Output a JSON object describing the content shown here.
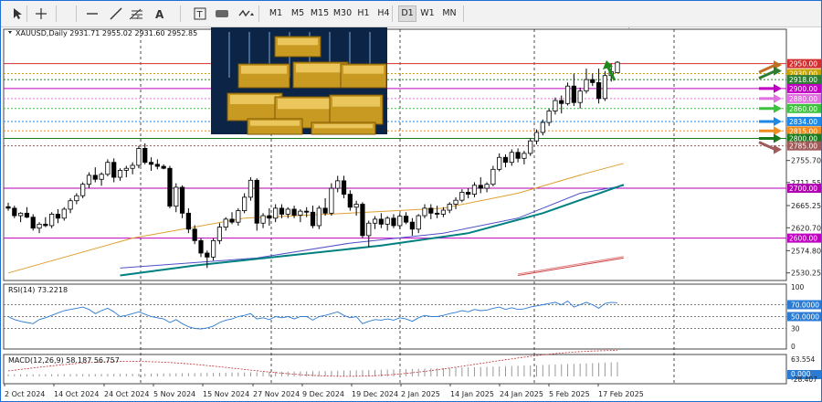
{
  "toolbar": {
    "tools": [
      "cursor-icon",
      "crosshair-icon",
      "horizontal-line-icon",
      "trend-line-icon",
      "fibonacci-icon",
      "text-icon",
      "text-label-icon",
      "rectangle-icon",
      "arrows-icon"
    ],
    "timeframes": [
      "M1",
      "M5",
      "M15",
      "M30",
      "H1",
      "H4",
      "D1",
      "W1",
      "MN"
    ],
    "active_timeframe": "D1"
  },
  "chart_data": {
    "type": "candlestick",
    "symbol_header": "XAUUSD,Daily  2931.71 2955.02 2931.60 2952.85",
    "y_ticks": [
      "2755.70",
      "2711.55",
      "2665.25",
      "2620.70",
      "2574.80",
      "2530.25"
    ],
    "x_ticks": [
      "2 Oct 2024",
      "14 Oct 2024",
      "24 Oct 2024",
      "5 Nov 2024",
      "15 Nov 2024",
      "27 Nov 2024",
      "9 Dec 2024",
      "19 Dec 2024",
      "2 Jan 2025",
      "14 Jan 2025",
      "24 Jan 2025",
      "5 Feb 2025",
      "17 Feb 2025"
    ],
    "ylim": [
      2515,
      3008
    ],
    "levels": [
      {
        "price": 2950,
        "label": "2950.00",
        "color": "#d32f2f"
      },
      {
        "price": 2930,
        "label": "2930.00",
        "color": "#c8a300"
      },
      {
        "price": 2918,
        "label": "2918.00",
        "color": "#2e7d32"
      },
      {
        "price": 2900,
        "label": "2900.00",
        "color": "#c000c0"
      },
      {
        "price": 2880,
        "label": "2880.00",
        "color": "#e070e0"
      },
      {
        "price": 2860,
        "label": "2860.00",
        "color": "#3cc23c"
      },
      {
        "price": 2834,
        "label": "2834.00",
        "color": "#1e88e5"
      },
      {
        "price": 2815,
        "label": "2815.00",
        "color": "#f08c1e"
      },
      {
        "price": 2800,
        "label": "2800.00",
        "color": "#1b7a1b"
      },
      {
        "price": 2785,
        "label": "2785.00",
        "color": "#a05a5a"
      },
      {
        "price": 2700,
        "label": "2700.00",
        "color": "#b000b0"
      },
      {
        "price": 2600,
        "label": "2600.00",
        "color": "#c000c0"
      }
    ],
    "candles": [
      [
        2663,
        2671,
        2655,
        2660
      ],
      [
        2660,
        2665,
        2640,
        2645
      ],
      [
        2645,
        2652,
        2632,
        2650
      ],
      [
        2650,
        2662,
        2640,
        2642
      ],
      [
        2642,
        2648,
        2615,
        2620
      ],
      [
        2620,
        2632,
        2610,
        2628
      ],
      [
        2628,
        2642,
        2622,
        2625
      ],
      [
        2625,
        2652,
        2620,
        2648
      ],
      [
        2648,
        2658,
        2630,
        2640
      ],
      [
        2640,
        2662,
        2635,
        2658
      ],
      [
        2658,
        2680,
        2650,
        2675
      ],
      [
        2675,
        2690,
        2668,
        2685
      ],
      [
        2685,
        2712,
        2680,
        2708
      ],
      [
        2708,
        2732,
        2700,
        2726
      ],
      [
        2726,
        2742,
        2712,
        2718
      ],
      [
        2718,
        2732,
        2705,
        2728
      ],
      [
        2728,
        2758,
        2724,
        2752
      ],
      [
        2752,
        2760,
        2712,
        2722
      ],
      [
        2722,
        2740,
        2715,
        2736
      ],
      [
        2736,
        2745,
        2722,
        2740
      ],
      [
        2740,
        2752,
        2728,
        2746
      ],
      [
        2746,
        2785,
        2740,
        2780
      ],
      [
        2780,
        2790,
        2748,
        2752
      ],
      [
        2752,
        2762,
        2735,
        2748
      ],
      [
        2748,
        2758,
        2738,
        2744
      ],
      [
        2744,
        2748,
        2738,
        2740
      ],
      [
        2740,
        2745,
        2660,
        2664
      ],
      [
        2664,
        2710,
        2652,
        2702
      ],
      [
        2702,
        2706,
        2640,
        2650
      ],
      [
        2650,
        2660,
        2610,
        2618
      ],
      [
        2618,
        2626,
        2588,
        2595
      ],
      [
        2595,
        2600,
        2562,
        2570
      ],
      [
        2570,
        2575,
        2540,
        2562
      ],
      [
        2562,
        2600,
        2555,
        2595
      ],
      [
        2595,
        2630,
        2588,
        2622
      ],
      [
        2622,
        2642,
        2615,
        2638
      ],
      [
        2638,
        2652,
        2628,
        2632
      ],
      [
        2632,
        2660,
        2625,
        2655
      ],
      [
        2655,
        2690,
        2650,
        2682
      ],
      [
        2682,
        2722,
        2675,
        2716
      ],
      [
        2716,
        2720,
        2615,
        2630
      ],
      [
        2630,
        2650,
        2620,
        2645
      ],
      [
        2645,
        2660,
        2625,
        2640
      ],
      [
        2640,
        2668,
        2632,
        2660
      ],
      [
        2660,
        2668,
        2640,
        2648
      ],
      [
        2648,
        2662,
        2640,
        2658
      ],
      [
        2658,
        2665,
        2640,
        2646
      ],
      [
        2646,
        2658,
        2632,
        2654
      ],
      [
        2654,
        2662,
        2642,
        2652
      ],
      [
        2652,
        2665,
        2620,
        2625
      ],
      [
        2625,
        2665,
        2618,
        2660
      ],
      [
        2660,
        2680,
        2645,
        2650
      ],
      [
        2650,
        2710,
        2645,
        2700
      ],
      [
        2700,
        2725,
        2692,
        2715
      ],
      [
        2715,
        2725,
        2680,
        2688
      ],
      [
        2688,
        2696,
        2655,
        2662
      ],
      [
        2662,
        2675,
        2645,
        2668
      ],
      [
        2668,
        2672,
        2600,
        2605
      ],
      [
        2605,
        2635,
        2582,
        2630
      ],
      [
        2630,
        2644,
        2618,
        2638
      ],
      [
        2638,
        2650,
        2620,
        2628
      ],
      [
        2628,
        2644,
        2615,
        2640
      ],
      [
        2640,
        2648,
        2620,
        2625
      ],
      [
        2625,
        2650,
        2618,
        2644
      ],
      [
        2644,
        2652,
        2628,
        2632
      ],
      [
        2632,
        2640,
        2605,
        2618
      ],
      [
        2618,
        2648,
        2610,
        2645
      ],
      [
        2645,
        2668,
        2640,
        2660
      ],
      [
        2660,
        2668,
        2638,
        2650
      ],
      [
        2650,
        2665,
        2640,
        2648
      ],
      [
        2648,
        2662,
        2642,
        2656
      ],
      [
        2656,
        2672,
        2650,
        2668
      ],
      [
        2668,
        2682,
        2658,
        2676
      ],
      [
        2676,
        2698,
        2672,
        2692
      ],
      [
        2692,
        2700,
        2680,
        2688
      ],
      [
        2688,
        2712,
        2682,
        2706
      ],
      [
        2706,
        2722,
        2690,
        2700
      ],
      [
        2700,
        2712,
        2692,
        2708
      ],
      [
        2708,
        2745,
        2704,
        2738
      ],
      [
        2738,
        2770,
        2734,
        2762
      ],
      [
        2762,
        2768,
        2742,
        2752
      ],
      [
        2752,
        2778,
        2745,
        2772
      ],
      [
        2772,
        2780,
        2752,
        2760
      ],
      [
        2760,
        2775,
        2748,
        2770
      ],
      [
        2770,
        2800,
        2765,
        2795
      ],
      [
        2795,
        2818,
        2788,
        2812
      ],
      [
        2812,
        2838,
        2806,
        2832
      ],
      [
        2832,
        2860,
        2825,
        2855
      ],
      [
        2855,
        2882,
        2848,
        2876
      ],
      [
        2876,
        2886,
        2850,
        2870
      ],
      [
        2870,
        2912,
        2866,
        2905
      ],
      [
        2905,
        2930,
        2865,
        2872
      ],
      [
        2872,
        2902,
        2860,
        2895
      ],
      [
        2895,
        2940,
        2890,
        2918
      ],
      [
        2918,
        2930,
        2905,
        2912
      ],
      [
        2912,
        2940,
        2870,
        2880
      ],
      [
        2880,
        2935,
        2875,
        2926
      ],
      [
        2926,
        2950,
        2914,
        2934
      ],
      [
        2931.71,
        2955.02,
        2931.6,
        2952.85
      ]
    ],
    "moving_averages": [
      {
        "color": "#e0a030",
        "points": [
          [
            0,
            2530
          ],
          [
            20,
            2600
          ],
          [
            38,
            2640
          ],
          [
            55,
            2650
          ],
          [
            70,
            2660
          ],
          [
            82,
            2690
          ],
          [
            93,
            2730
          ],
          [
            99,
            2750
          ]
        ]
      },
      {
        "color": "#5050c8",
        "points": [
          [
            18,
            2540
          ],
          [
            40,
            2560
          ],
          [
            55,
            2590
          ],
          [
            70,
            2610
          ],
          [
            82,
            2640
          ],
          [
            92,
            2690
          ],
          [
            99,
            2705
          ]
        ]
      },
      {
        "color": "#008080",
        "points": [
          [
            18,
            2525
          ],
          [
            30,
            2545
          ],
          [
            45,
            2565
          ],
          [
            60,
            2585
          ],
          [
            74,
            2610
          ],
          [
            86,
            2650
          ],
          [
            94,
            2685
          ],
          [
            99,
            2707
          ]
        ]
      }
    ],
    "overlay_lines": [
      {
        "color": "#d04040",
        "points": [
          [
            82,
            2525
          ],
          [
            99,
            2560
          ]
        ]
      },
      {
        "color": "#e08080",
        "points": [
          [
            82,
            2528
          ],
          [
            99,
            2563
          ]
        ]
      }
    ],
    "rsi": {
      "label": "RSI(14) 73.2218",
      "ticks": [
        "100",
        "70.0000",
        "50.0000",
        "30",
        "0"
      ],
      "values": [
        50,
        45,
        42,
        40,
        38,
        45,
        48,
        52,
        56,
        60,
        62,
        64,
        66,
        62,
        55,
        60,
        64,
        58,
        50,
        52,
        55,
        58,
        54,
        50,
        48,
        46,
        40,
        45,
        38,
        33,
        30,
        29,
        31,
        34,
        40,
        44,
        46,
        50,
        52,
        55,
        46,
        48,
        45,
        50,
        48,
        50,
        46,
        50,
        50,
        44,
        50,
        52,
        55,
        58,
        52,
        48,
        50,
        38,
        42,
        45,
        44,
        46,
        44,
        48,
        46,
        42,
        48,
        52,
        50,
        50,
        52,
        55,
        57,
        60,
        58,
        62,
        60,
        61,
        64,
        66,
        62,
        65,
        62,
        63,
        66,
        68,
        70,
        72,
        74,
        70,
        76,
        66,
        70,
        74,
        70,
        64,
        72,
        74,
        73.2
      ]
    },
    "macd": {
      "label": "MACD(12,26,9) 58.187 56.757",
      "ticks": [
        "63.554",
        "0.000",
        "-28.407"
      ]
    }
  }
}
